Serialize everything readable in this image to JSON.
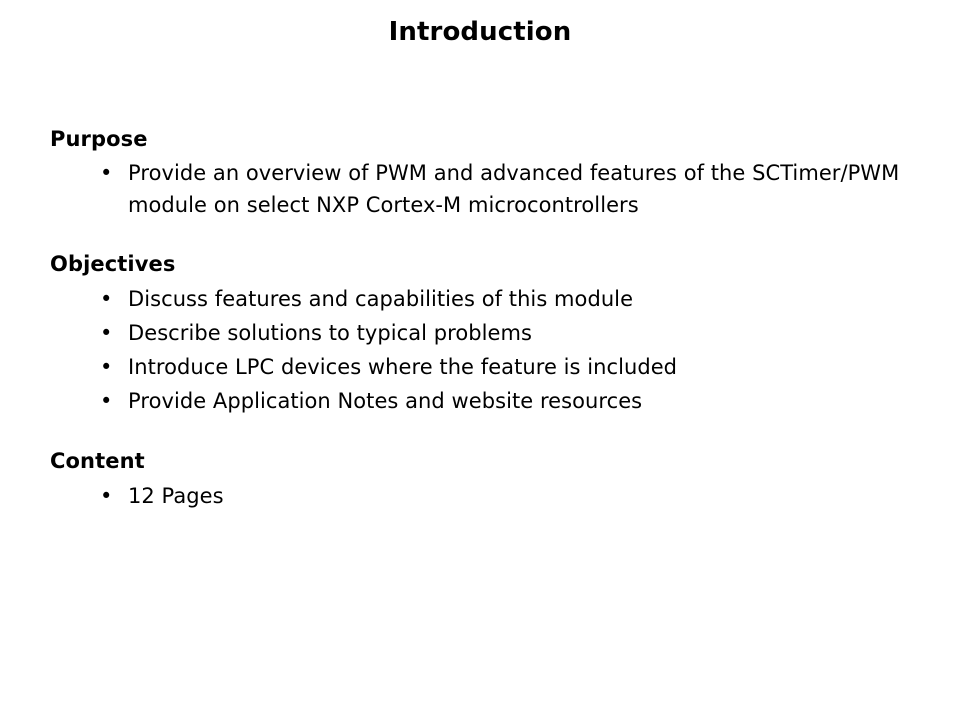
{
  "slide": {
    "title": "Introduction",
    "background_color": "#ffffff",
    "text_color": "#000000",
    "bullet_glyph": "•",
    "sections": [
      {
        "heading": "Purpose",
        "bullets": [
          "Provide an overview of PWM and advanced features of the SCTimer/PWM module on select NXP Cortex-M microcontrollers"
        ]
      },
      {
        "heading": "Objectives",
        "bullets": [
          "Discuss features and capabilities of this module",
          "Describe solutions to typical problems",
          "Introduce LPC devices where the feature is included",
          "Provide Application Notes and website resources"
        ]
      },
      {
        "heading": "Content",
        "bullets": [
          "12 Pages"
        ]
      }
    ]
  }
}
